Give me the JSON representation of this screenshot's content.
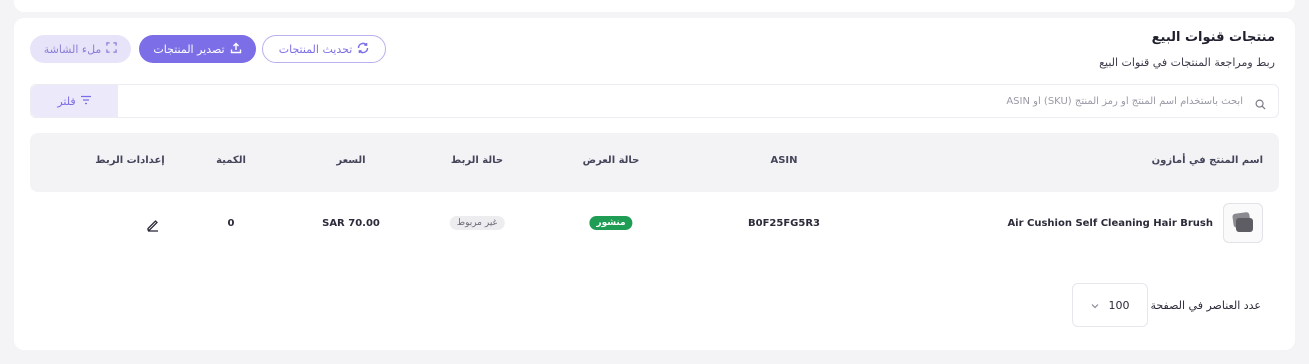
{
  "colors": {
    "accent": "#7c6ee6",
    "published_badge": "#1f9d55",
    "background": "#f4f4f6"
  },
  "header": {
    "title": "منتجات قنوات البيع",
    "subtitle": "ربط ومراجعة المنتجات في قنوات البيع"
  },
  "toolbar": {
    "refresh_label": "تحديث المنتجات",
    "refresh_icon": "refresh-icon",
    "export_label": "تصدير المنتجات",
    "export_icon": "upload-icon",
    "fullscreen_label": "ملء الشاشة",
    "fullscreen_icon": "expand-icon"
  },
  "search": {
    "placeholder": "ابحث باستخدام اسم المنتج أو رمز المنتج (SKU) أو ASIN",
    "value": "",
    "filter_label": "فلتر",
    "filter_icon": "filter-icon"
  },
  "table": {
    "columns": {
      "product": "اسم المنتج في أمازون",
      "asin": "ASIN",
      "display_status": "حالة العرض",
      "link_status": "حالة الربط",
      "price": "السعر",
      "quantity": "الكمية",
      "link_settings": "إعدادات الربط"
    },
    "rows": [
      {
        "product_name": "Air Cushion Self Cleaning Hair Brush",
        "asin": "B0F25FG5R3",
        "display_status": "منشور",
        "link_status": "غير مربوط",
        "price": "SAR 70.00",
        "quantity": "0"
      }
    ]
  },
  "pagination": {
    "per_page_label": "عدد العناصر في الصفحة",
    "per_page_value": "100"
  }
}
